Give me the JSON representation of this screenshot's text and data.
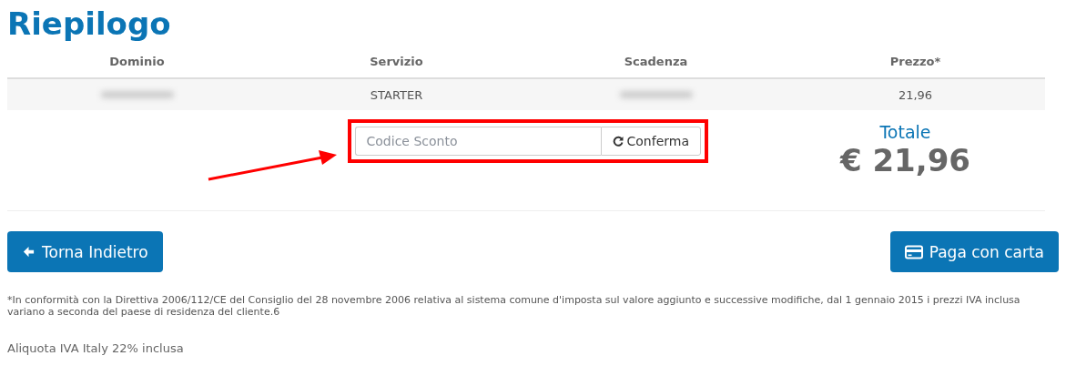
{
  "title": "Riepilogo",
  "table": {
    "columns": [
      "Dominio",
      "Servizio",
      "Scadenza",
      "Prezzo*"
    ],
    "rows": [
      {
        "cells": [
          {
            "kind": "redacted"
          },
          {
            "kind": "text",
            "text": "STARTER"
          },
          {
            "kind": "redacted"
          },
          {
            "kind": "text",
            "text": "21,96"
          }
        ]
      }
    ]
  },
  "coupon": {
    "placeholder": "Codice Sconto",
    "button": "Conferma",
    "highlighted": true
  },
  "total": {
    "label": "Totale",
    "amount": "€ 21,96"
  },
  "buttons": [
    {
      "kind": "back",
      "label": "Torna Indietro"
    },
    {
      "kind": "card",
      "label": "Paga con carta"
    }
  ],
  "footnote": "*In conformità con la Direttiva 2006/112/CE del Consiglio del 28 novembre 2006 relativa al sistema comune d'imposta sul valore aggiunto e successive modifiche, dal 1 gennaio 2015 i prezzi IVA inclusa variano a seconda del paese di residenza del cliente.6",
  "vat_note": "Aliquota IVA Italy 22% inclusa"
}
